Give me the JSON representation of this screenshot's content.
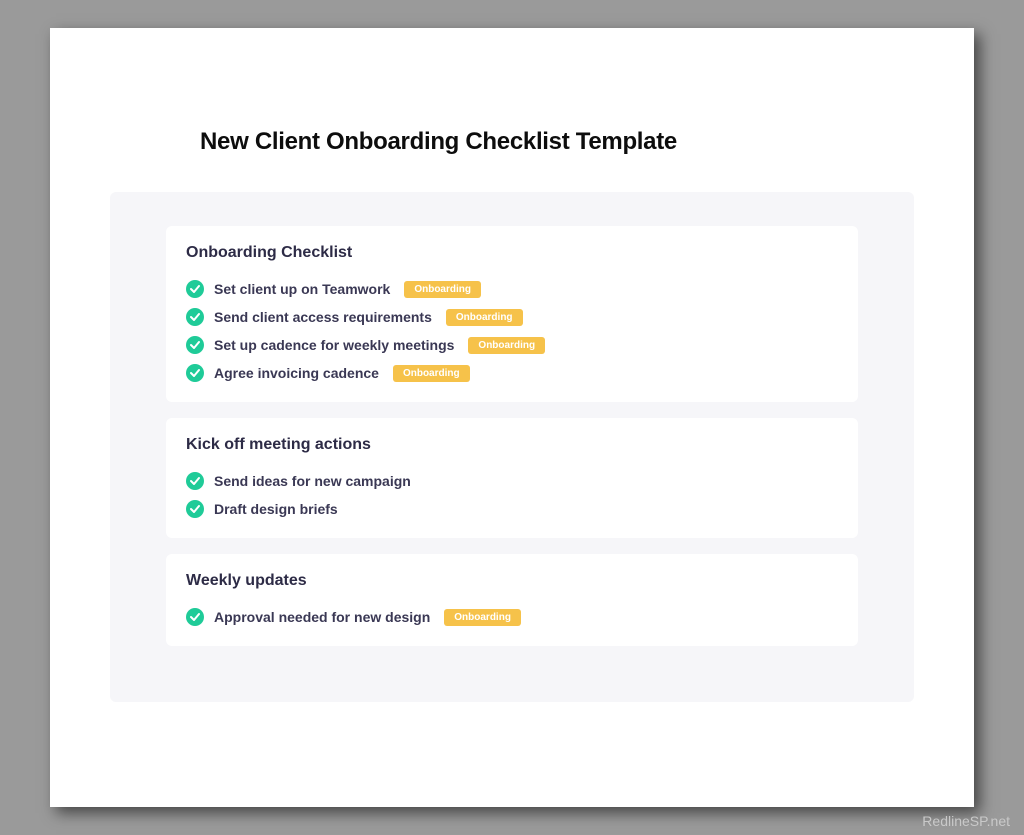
{
  "title": "New Client Onboarding Checklist Template",
  "tag_label": "Onboarding",
  "sections": [
    {
      "heading": "Onboarding Checklist",
      "items": [
        {
          "label": "Set client up on Teamwork",
          "tag": true
        },
        {
          "label": "Send client access requirements",
          "tag": true
        },
        {
          "label": "Set up cadence for weekly meetings",
          "tag": true
        },
        {
          "label": "Agree invoicing cadence",
          "tag": true
        }
      ]
    },
    {
      "heading": "Kick off meeting actions",
      "items": [
        {
          "label": "Send ideas for new campaign",
          "tag": false
        },
        {
          "label": "Draft design briefs",
          "tag": false
        }
      ]
    },
    {
      "heading": "Weekly updates",
      "items": [
        {
          "label": "Approval needed for new design",
          "tag": true
        }
      ]
    }
  ],
  "watermark": "RedlineSP.net"
}
